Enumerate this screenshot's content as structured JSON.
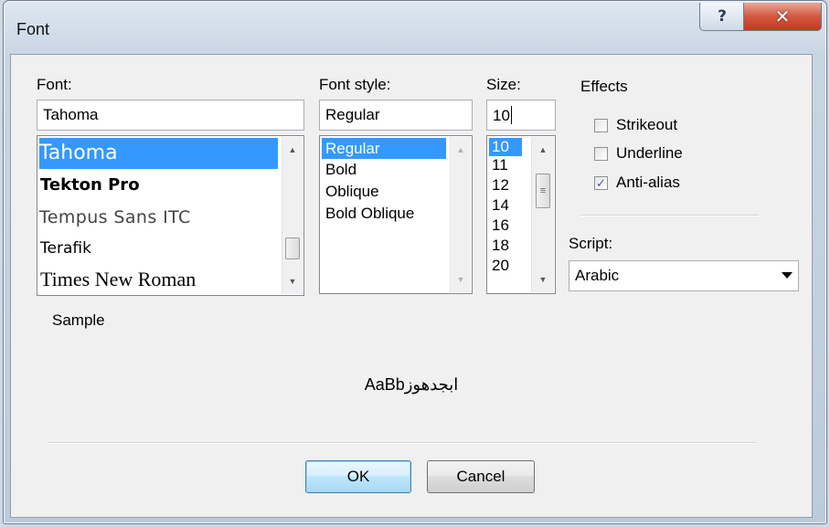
{
  "window": {
    "title": "Font",
    "help_glyph": "?",
    "close_glyph": "✕"
  },
  "font": {
    "label": "Font:",
    "value": "Tahoma",
    "items": [
      "Tahoma",
      "Tekton Pro",
      "Tempus Sans ITC",
      "Terafik",
      "Times New Roman"
    ],
    "selected": "Tahoma"
  },
  "font_style": {
    "label": "Font style:",
    "value": "Regular",
    "items": [
      "Regular",
      "Bold",
      "Oblique",
      "Bold Oblique"
    ],
    "selected": "Regular"
  },
  "size": {
    "label": "Size:",
    "value": "10",
    "items": [
      "10",
      "11",
      "12",
      "14",
      "16",
      "18",
      "20"
    ],
    "selected": "10"
  },
  "effects": {
    "label": "Effects",
    "strikeout": {
      "label": "Strikeout",
      "checked": false
    },
    "underline": {
      "label": "Underline",
      "checked": false
    },
    "antialias": {
      "label": "Anti-alias",
      "checked": true
    }
  },
  "script": {
    "label": "Script:",
    "value": "Arabic"
  },
  "sample": {
    "label": "Sample",
    "text": "AaBbابجدهوز"
  },
  "buttons": {
    "ok": "OK",
    "cancel": "Cancel"
  },
  "colors": {
    "selection": "#3399ff",
    "title_bg": "#cbd8e6",
    "close": "#c9462c"
  }
}
